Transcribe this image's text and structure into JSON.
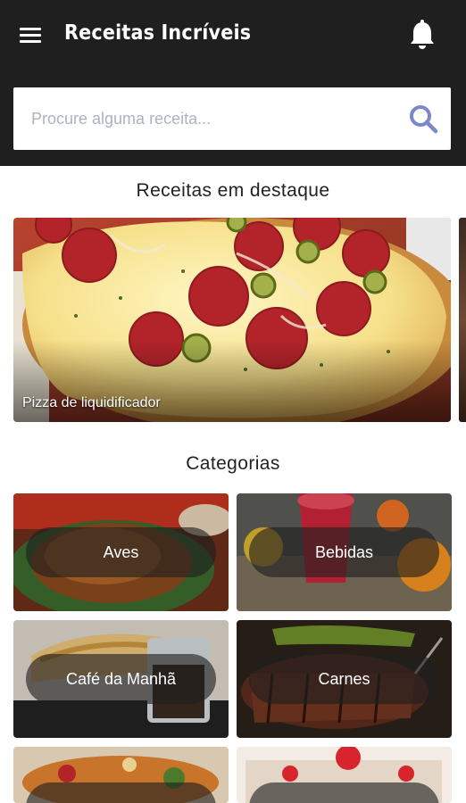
{
  "app": {
    "title": "Receitas Incríveis"
  },
  "search": {
    "placeholder": "Procure alguma receita..."
  },
  "featured": {
    "section_title": "Receitas em destaque",
    "items": [
      {
        "label": "Pizza de liquidificador"
      }
    ]
  },
  "categories": {
    "section_title": "Categorias",
    "items": [
      {
        "label": "Aves"
      },
      {
        "label": "Bebidas"
      },
      {
        "label": "Café da Manhã"
      },
      {
        "label": "Carnes"
      }
    ]
  },
  "colors": {
    "appbar": "#1f1f1f",
    "search_icon": "#7a88c9",
    "placeholder": "#aab3c4"
  },
  "icons": {
    "menu": "menu-icon",
    "notifications": "bell-icon",
    "search": "search-icon"
  }
}
